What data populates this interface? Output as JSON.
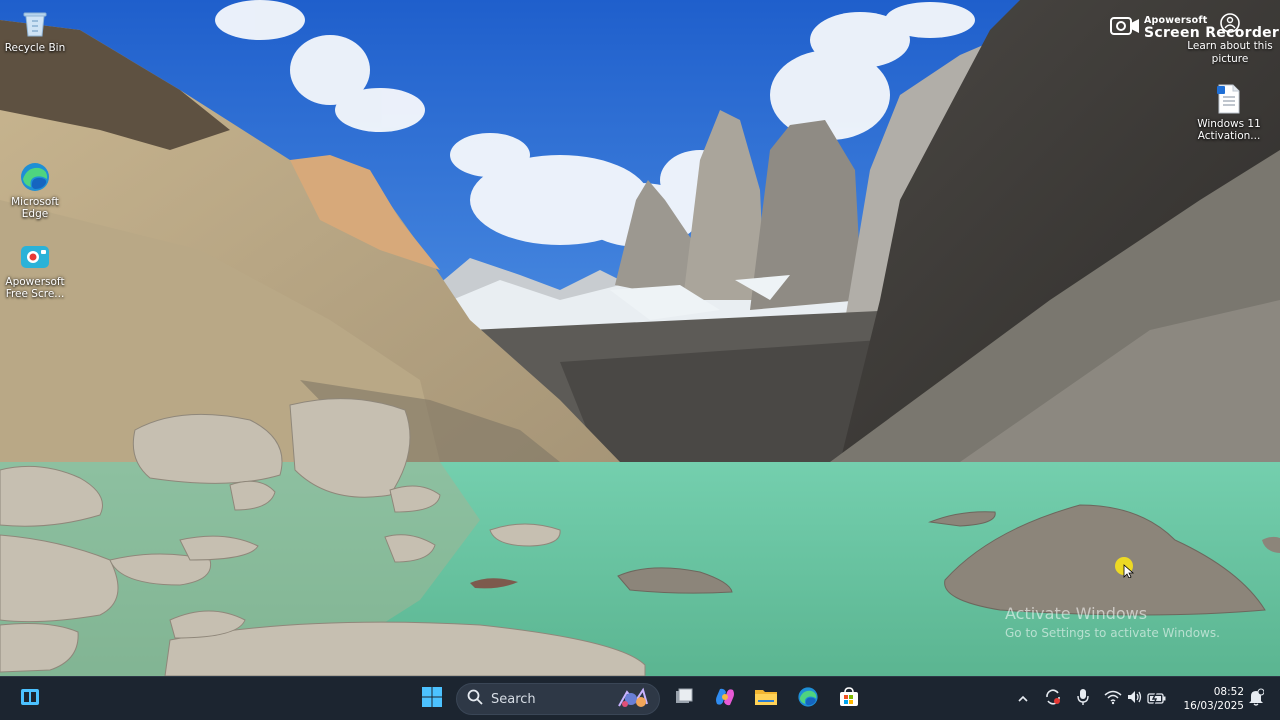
{
  "desktop": {
    "icons": [
      {
        "label": "Recycle Bin",
        "icon": "recycle-bin-icon"
      },
      {
        "label": "Microsoft Edge",
        "icon": "edge-icon"
      },
      {
        "label": "Apowersoft Free Scre...",
        "icon": "apowersoft-icon"
      },
      {
        "label": "Windows 11 Activation...",
        "icon": "text-file-icon"
      }
    ],
    "learn_about": {
      "label": "Learn about this picture",
      "icon": "camera-icon"
    },
    "recorder_watermark": {
      "line1": "Apowersoft",
      "line2": "Screen Recorder"
    },
    "activation_watermark": {
      "title": "Activate Windows",
      "subtitle": "Go to Settings to activate Windows."
    }
  },
  "taskbar": {
    "search_label": "Search",
    "pinned": [
      "task-view-icon",
      "start-icon",
      "desktop-app-icon",
      "copilot-icon",
      "file-explorer-icon",
      "edge-icon",
      "store-icon"
    ],
    "tray": [
      "chevron-up-icon",
      "sync-icon",
      "microphone-icon",
      "wifi-icon",
      "volume-icon",
      "battery-icon"
    ],
    "time": "08:52",
    "date": "16/03/2025"
  },
  "colors": {
    "taskbar_bg": "#1c2530",
    "sky": "#2a6fd6",
    "lake": "#67c4a0",
    "accent": "#4cc2ff"
  }
}
